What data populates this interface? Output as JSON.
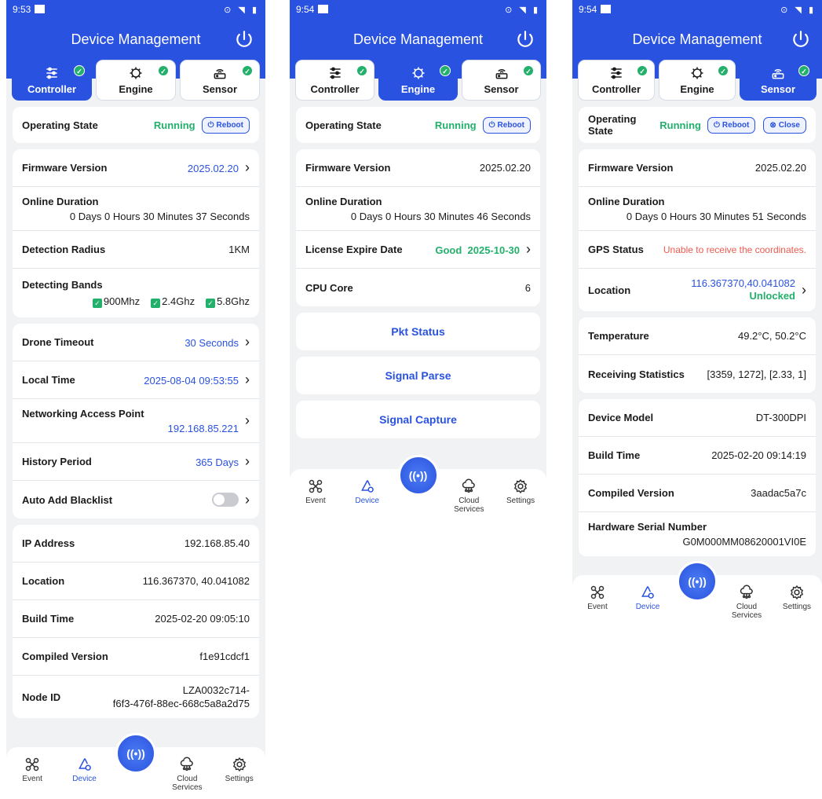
{
  "common": {
    "app_title": "Device Management",
    "tabs": [
      "Controller",
      "Engine",
      "Sensor"
    ],
    "nav": [
      "Event",
      "Device",
      "Cloud Services",
      "Settings"
    ],
    "center_icon": "((•))",
    "operating_state_label": "Operating State",
    "running": "Running",
    "reboot": "Reboot",
    "chev": "›",
    "check": "✓"
  },
  "s1": {
    "time": "9:53",
    "firmware_label": "Firmware Version",
    "firmware_value": "2025.02.20",
    "online_label": "Online Duration",
    "online_value": "0 Days 0 Hours 30 Minutes 37 Seconds",
    "radius_label": "Detection Radius",
    "radius_value": "1KM",
    "bands_label": "Detecting Bands",
    "bands": [
      "900Mhz",
      "2.4Ghz",
      "5.8Ghz"
    ],
    "timeout_label": "Drone Timeout",
    "timeout_value": "30 Seconds",
    "localtime_label": "Local Time",
    "localtime_value": "2025-08-04 09:53:55",
    "ap_label": "Networking Access Point",
    "ap_value": "192.168.85.221",
    "history_label": "History Period",
    "history_value": "365 Days",
    "blacklist_label": "Auto Add Blacklist",
    "ip_label": "IP Address",
    "ip_value": "192.168.85.40",
    "location_label": "Location",
    "location_value": "116.367370, 40.041082",
    "build_label": "Build Time",
    "build_value": "2025-02-20 09:05:10",
    "compiled_label": "Compiled Version",
    "compiled_value": "f1e91cdcf1",
    "node_label": "Node ID",
    "node_value_1": "LZA0032c714-",
    "node_value_2": "f6f3-476f-88ec-668c5a8a2d75"
  },
  "s2": {
    "time": "9:54",
    "firmware_label": "Firmware Version",
    "firmware_value": "2025.02.20",
    "online_label": "Online Duration",
    "online_value": "0 Days 0 Hours 30 Minutes 46 Seconds",
    "license_label": "License Expire Date",
    "license_status": "Good",
    "license_value": "2025-10-30",
    "cpu_label": "CPU Core",
    "cpu_value": "6",
    "btn_pkt": "Pkt Status",
    "btn_parse": "Signal Parse",
    "btn_capture": "Signal Capture"
  },
  "s3": {
    "time": "9:54",
    "close": "Close",
    "firmware_label": "Firmware Version",
    "firmware_value": "2025.02.20",
    "online_label": "Online Duration",
    "online_value": "0 Days 0 Hours 30 Minutes 51 Seconds",
    "gps_label": "GPS Status",
    "gps_value": "Unable to receive the coordinates.",
    "location_label": "Location",
    "location_value": "116.367370,40.041082",
    "location_status": "Unlocked",
    "temp_label": "Temperature",
    "temp_value": "49.2°C, 50.2°C",
    "recv_label": "Receiving Statistics",
    "recv_value": "[3359, 1272], [2.33, 1]",
    "model_label": "Device Model",
    "model_value": "DT-300DPI",
    "build_label": "Build Time",
    "build_value": "2025-02-20 09:14:19",
    "compiled_label": "Compiled Version",
    "compiled_value": "3aadac5a7c",
    "serial_label": "Hardware Serial Number",
    "serial_value": "G0M000MM08620001VI0E"
  },
  "colors": {
    "primary": "#2a52e0",
    "success": "#22b06b",
    "error": "#ee5a4f"
  }
}
